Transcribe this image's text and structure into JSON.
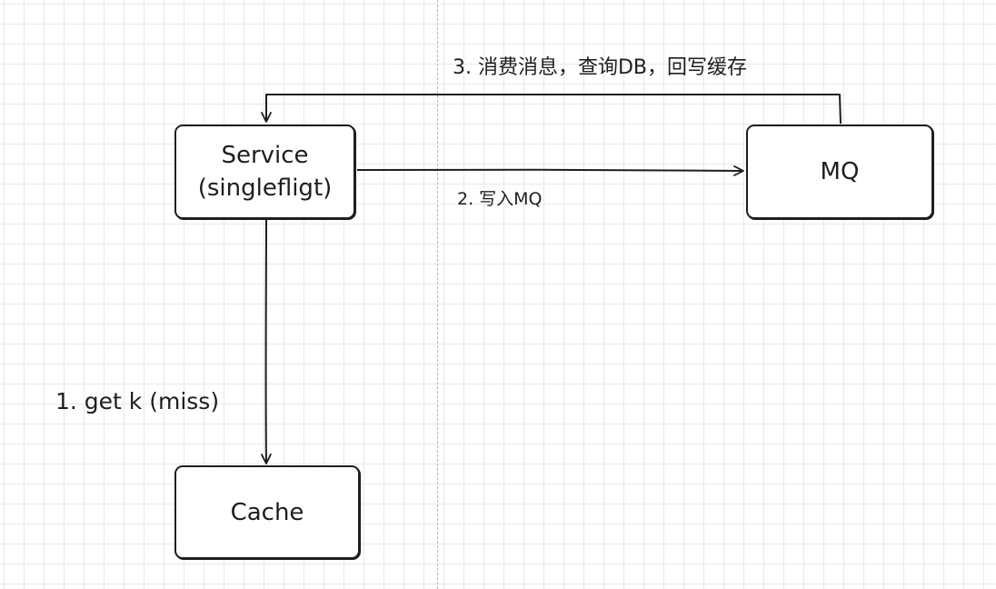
{
  "diagram": {
    "nodes": {
      "service": {
        "line1": "Service",
        "line2": "(singlefligt)"
      },
      "mq": {
        "label": "MQ"
      },
      "cache": {
        "label": "Cache"
      }
    },
    "edges": {
      "step1": {
        "label": "1. get k (miss)",
        "from": "service",
        "to": "cache"
      },
      "step2": {
        "label": "2. 写入MQ",
        "from": "service",
        "to": "mq"
      },
      "step3": {
        "label": "3. 消费消息，查询DB，回写缓存",
        "from": "mq",
        "to": "service"
      }
    },
    "colors": {
      "stroke": "#1e1e1e",
      "grid": "#e8e8e8",
      "background": "#ffffff",
      "divider": "#b8b8b8"
    }
  }
}
